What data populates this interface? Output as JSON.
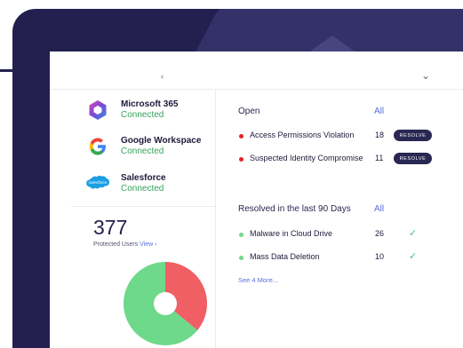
{
  "integrations": [
    {
      "name": "Microsoft 365",
      "status": "Connected",
      "icon": "microsoft-365-icon"
    },
    {
      "name": "Google Workspace",
      "status": "Connected",
      "icon": "google-icon"
    },
    {
      "name": "Salesforce",
      "status": "Connected",
      "icon": "salesforce-icon",
      "icon_text": "salesforce"
    }
  ],
  "protected_users": {
    "count": "377",
    "label": "Protected Users",
    "view_link": "View ›"
  },
  "pie": {
    "red_fraction": 0.36,
    "green_fraction": 0.64,
    "colors": {
      "red": "#ef5f64",
      "green": "#6ed98a"
    }
  },
  "open": {
    "title": "Open",
    "all_link": "All",
    "items": [
      {
        "label": "Access Permissions Violation",
        "count": "18",
        "action": "RESOLVE"
      },
      {
        "label": "Suspected Identity Compromise",
        "count": "11",
        "action": "RESOLVE"
      }
    ]
  },
  "resolved": {
    "title": "Resolved in the last 90 Days",
    "all_link": "All",
    "items": [
      {
        "label": "Malware in Cloud Drive",
        "count": "26"
      },
      {
        "label": "Mass Data Deletion",
        "count": "10"
      }
    ],
    "see_more": "See 4 More..."
  },
  "colors": {
    "navy": "#231f4f",
    "accent": "#5b6fe0",
    "open_dot": "#e8202a",
    "resolved_dot": "#6ed98a",
    "connected": "#3aa35f"
  }
}
